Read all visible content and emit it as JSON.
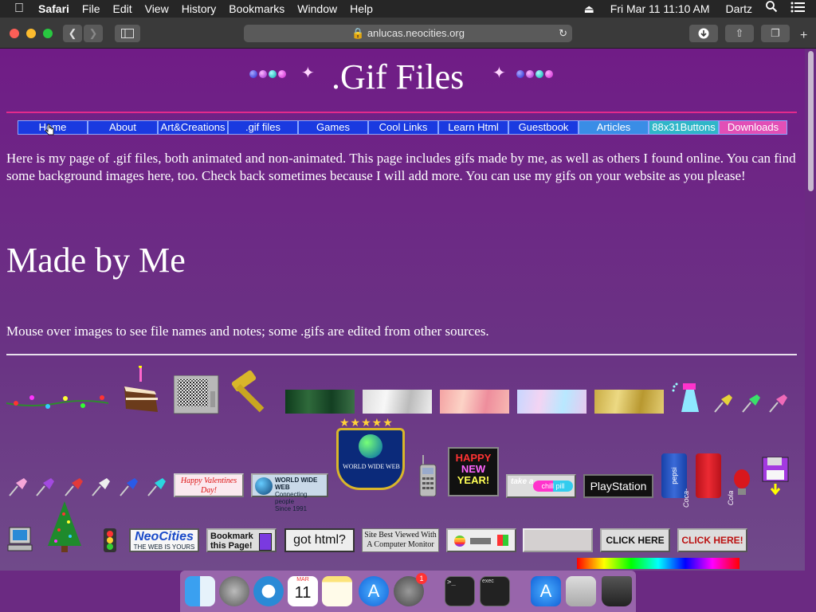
{
  "menubar": {
    "app": "Safari",
    "items": [
      "File",
      "Edit",
      "View",
      "History",
      "Bookmarks",
      "Window",
      "Help"
    ],
    "clock": "Fri Mar 11  11:10 AM",
    "user": "Dartz"
  },
  "browser": {
    "url": "anlucas.neocities.org"
  },
  "page": {
    "title": ".Gif Files",
    "nav": [
      {
        "label": "Home",
        "color": "#1a3ae0"
      },
      {
        "label": "About",
        "color": "#1a3ae0"
      },
      {
        "label": "Art&Creations",
        "color": "#1a3ae0"
      },
      {
        "label": ".gif files",
        "color": "#1a3ae0"
      },
      {
        "label": "Games",
        "color": "#1a3ae0"
      },
      {
        "label": "Cool Links",
        "color": "#1a3ae0"
      },
      {
        "label": "Learn Html",
        "color": "#1a3ae0"
      },
      {
        "label": "Guestbook",
        "color": "#1a3ae0"
      },
      {
        "label": "Articles",
        "color": "#3a8de6"
      },
      {
        "label": "88x31Buttons",
        "color": "#2fb6c8"
      },
      {
        "label": "Downloads",
        "color": "#e24fb6"
      }
    ],
    "intro": "Here is my page of .gif files, both animated and non-animated. This page includes gifs made by me, as well as others I found online. You can find some background images here, too. Check back sometimes because I will add more. You can use my gifs on your website as you please!",
    "heading": "Made by Me",
    "mouse_note": "Mouse over images to see file names and notes; some .gifs are edited from other sources.",
    "gifs": {
      "www_badge": "WORLD WIDE WEB",
      "happy_new_year": [
        "HAPPY",
        "NEW",
        "YEAR!"
      ],
      "take_a": "take a",
      "chill_pill": "chill pill",
      "playstation": "PlayStation",
      "pepsi": "pepsi",
      "cocacola": "Coca-Cola",
      "valentines": "Happy Valentines Day!",
      "www_since": [
        "WORLD WIDE WEB",
        "Connecting people",
        "Since 1991"
      ],
      "neocities": "NeoCities",
      "neocities_sub": "THE WEB IS YOURS",
      "bookmark": [
        "Bookmark",
        "this Page!"
      ],
      "got_html": "got html?",
      "best_viewed": [
        "Site Best Viewed With",
        "A Computer Monitor"
      ],
      "click_here_1": "CLICK HERE",
      "click_here_2": "CLICK HERE!"
    }
  },
  "icons": {
    "dock": [
      "finder-icon",
      "launchpad-icon",
      "safari-icon",
      "calendar-icon",
      "notes-icon",
      "app-store-icon",
      "system-preferences-icon",
      "terminal-icon",
      "exec-icon",
      "applications-folder-icon",
      "documents-icon",
      "trash-icon"
    ],
    "calendar_month": "MAR",
    "calendar_day": "11",
    "badge_count": "1",
    "exec_label": "exec"
  }
}
